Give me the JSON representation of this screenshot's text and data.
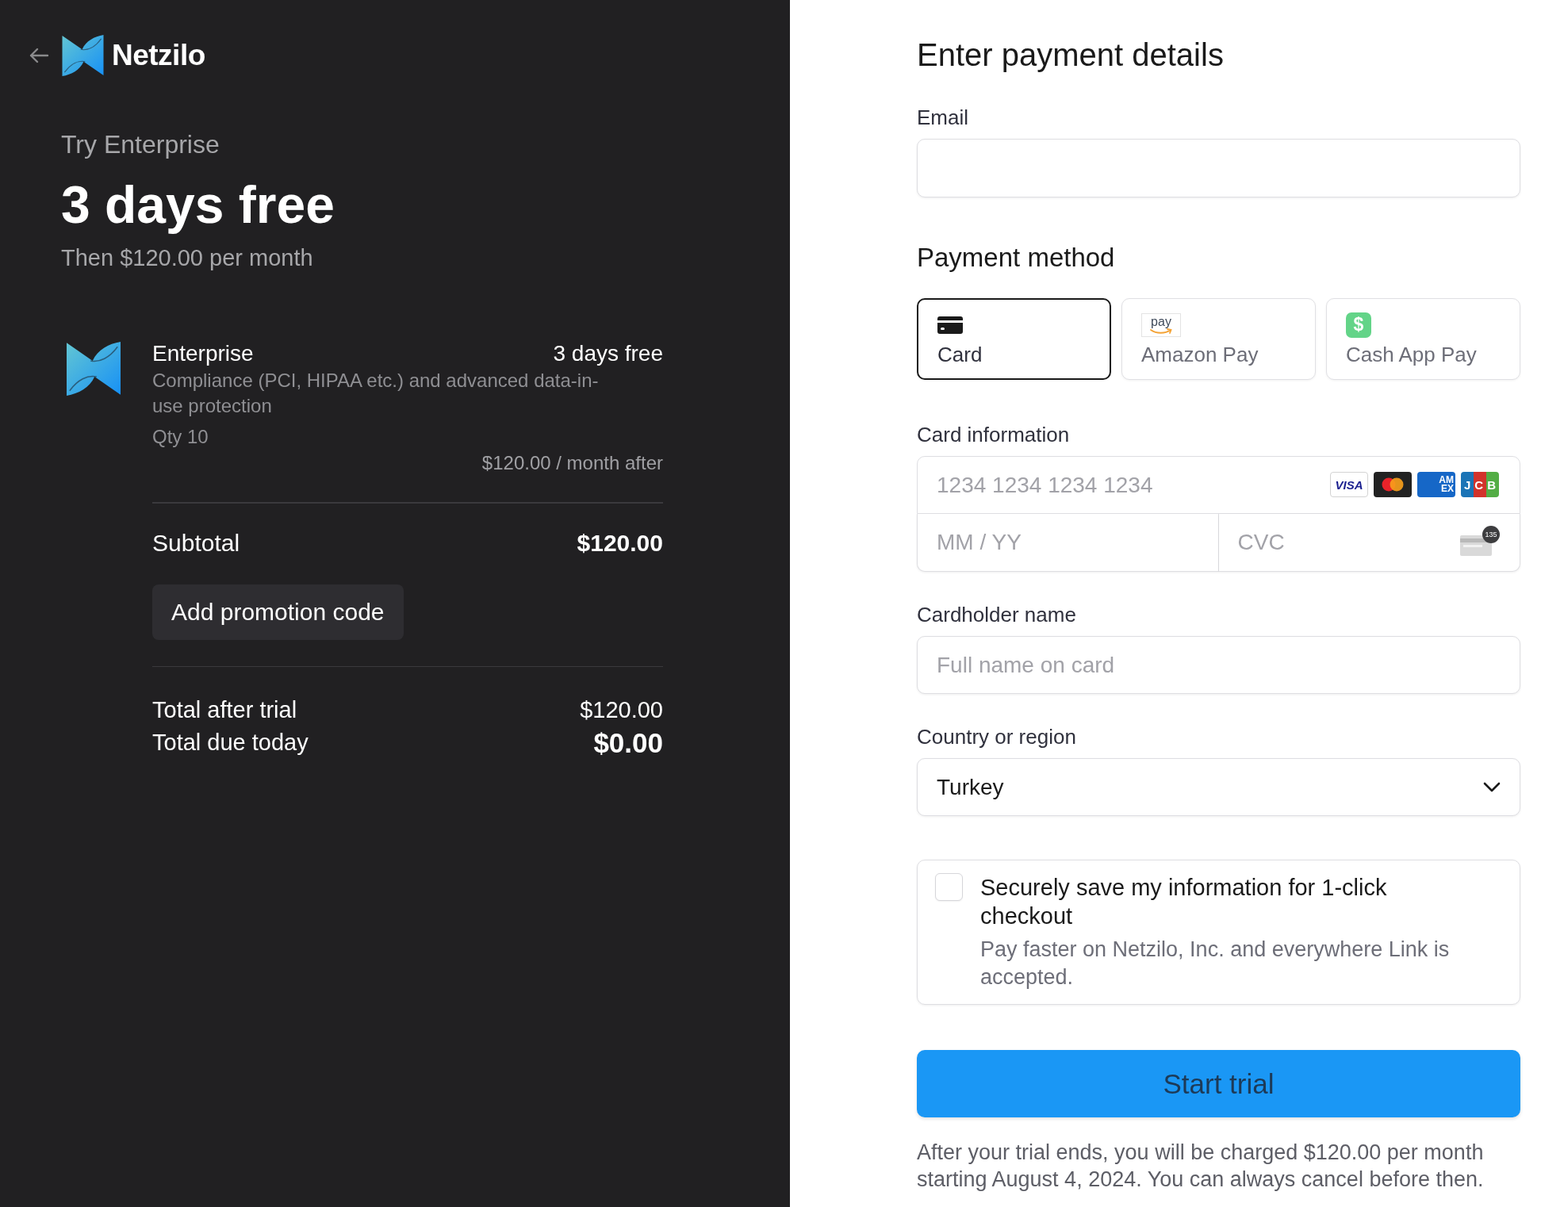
{
  "header": {
    "brand": "Netzilo"
  },
  "summary": {
    "eyebrow": "Try Enterprise",
    "headline": "3 days free",
    "subline": "Then $120.00 per month"
  },
  "line_items": [
    {
      "name": "Enterprise",
      "trial": "3 days free",
      "description": "Compliance (PCI, HIPAA etc.) and advanced data-in-use protection",
      "quantity": "Qty 10",
      "price_after": "$120.00 / month after"
    }
  ],
  "subtotal": {
    "label": "Subtotal",
    "amount": "$120.00"
  },
  "promotion": {
    "button": "Add promotion code"
  },
  "totals": [
    {
      "kind": "after_trial",
      "label": "Total after trial",
      "amount": "$120.00"
    },
    {
      "kind": "due_today",
      "label": "Total due today",
      "amount": "$0.00"
    }
  ],
  "payment": {
    "title": "Enter payment details",
    "email": {
      "label": "Email"
    },
    "method_heading": "Payment method",
    "methods": [
      {
        "kind": "card",
        "label": "Card",
        "selected": true
      },
      {
        "kind": "amazon_pay",
        "label": "Amazon Pay",
        "icon_text": "pay",
        "selected": false
      },
      {
        "kind": "cash_app",
        "label": "Cash App Pay",
        "icon_text": "$",
        "selected": false
      }
    ],
    "card_information": {
      "label": "Card information",
      "number_placeholder": "1234 1234 1234 1234",
      "brands": [
        {
          "kind": "visa",
          "text": "VISA"
        },
        {
          "kind": "mastercard"
        },
        {
          "kind": "amex",
          "text": "AM EX"
        },
        {
          "kind": "jcb",
          "text": "JCB"
        }
      ],
      "expiry_placeholder": "MM / YY",
      "cvc_placeholder": "CVC",
      "cvc_hint": "135"
    },
    "cardholder": {
      "label": "Cardholder name",
      "placeholder": "Full name on card"
    },
    "country": {
      "label": "Country or region",
      "value": "Turkey"
    },
    "save_info": {
      "checked": false,
      "title": "Securely save my information for 1-click checkout",
      "description": "Pay faster on Netzilo, Inc. and everywhere Link is accepted."
    },
    "submit": "Start trial",
    "notice": "After your trial ends, you will be charged $120.00 per month starting August 4, 2024. You can always cancel before then."
  }
}
